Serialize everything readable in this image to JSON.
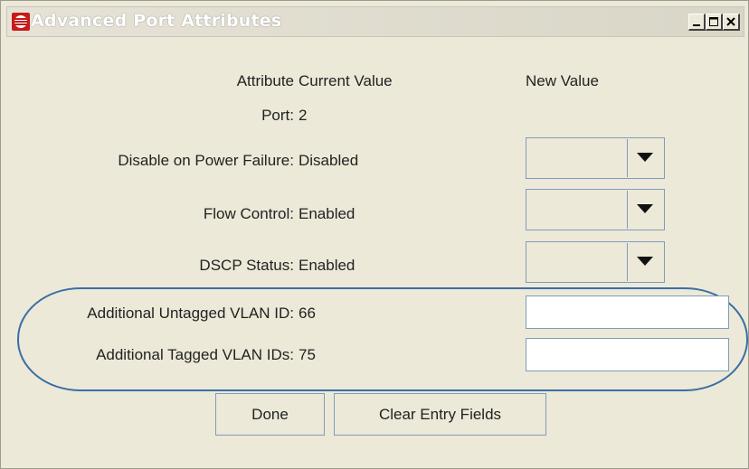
{
  "window": {
    "title": "Advanced Port Attributes",
    "controls": [
      "minimize",
      "maximize",
      "close"
    ]
  },
  "header": {
    "attribute": "Attribute",
    "current_value": "Current Value",
    "new_value": "New Value"
  },
  "port": {
    "label": "Port:",
    "value": "2"
  },
  "attributes": [
    {
      "label": "Disable on Power Failure:",
      "current": "Disabled",
      "control": "dropdown",
      "new_value": ""
    },
    {
      "label": "Flow Control:",
      "current": "Enabled",
      "control": "dropdown",
      "new_value": ""
    },
    {
      "label": "DSCP Status:",
      "current": "Enabled",
      "control": "dropdown",
      "new_value": ""
    },
    {
      "label": "Additional Untagged VLAN ID:",
      "current": "66",
      "control": "text",
      "new_value": ""
    },
    {
      "label": "Additional Tagged VLAN IDs:",
      "current": "75",
      "control": "text",
      "new_value": ""
    }
  ],
  "buttons": {
    "done": "Done",
    "clear": "Clear Entry Fields"
  },
  "colors": {
    "window_bg": "#ece9d8",
    "field_border": "#7f9db9",
    "highlight_oval": "#3a6ea5",
    "icon_red": "#c81a1a"
  }
}
